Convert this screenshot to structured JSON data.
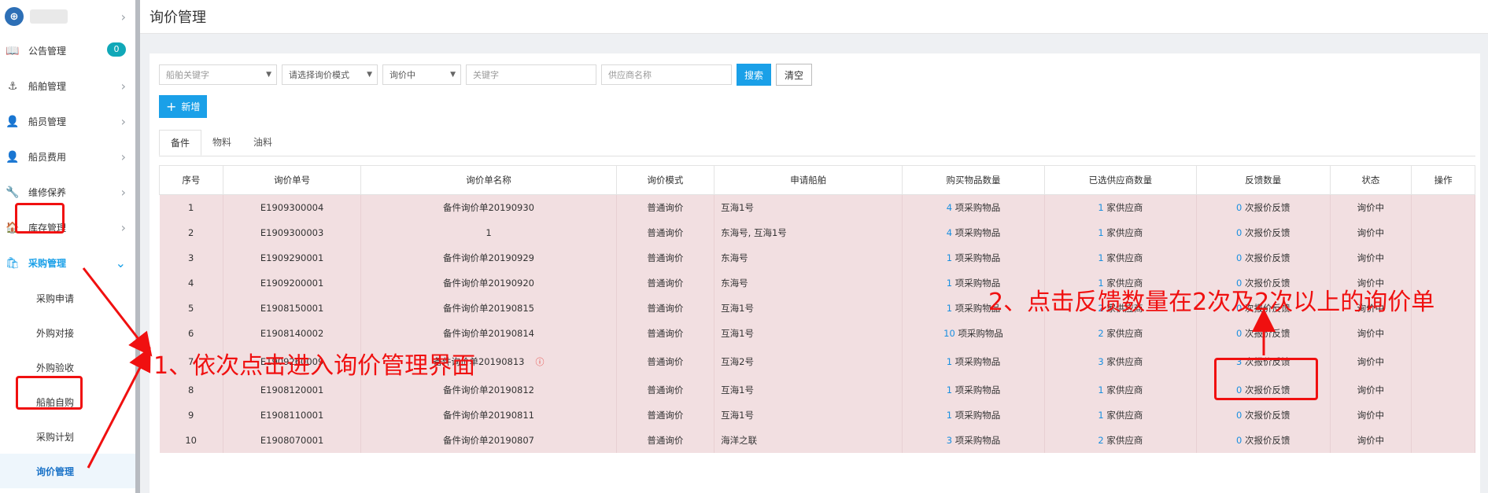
{
  "sidebar": {
    "logo_icon": "company-logo-icon",
    "menu": [
      {
        "label": "公告管理",
        "icon": "notice-icon",
        "badge": "0"
      },
      {
        "label": "船舶管理",
        "icon": "anchor-icon"
      },
      {
        "label": "船员管理",
        "icon": "crew-icon"
      },
      {
        "label": "船员费用",
        "icon": "crew-fee-icon"
      },
      {
        "label": "维修保养",
        "icon": "maintenance-icon"
      },
      {
        "label": "库存管理",
        "icon": "inventory-icon"
      },
      {
        "label": "采购管理",
        "icon": "purchase-icon"
      }
    ],
    "submenu": [
      "采购申请",
      "外购对接",
      "外购验收",
      "船舶自购",
      "采购计划",
      "询价管理"
    ]
  },
  "header": {
    "title": "询价管理"
  },
  "filters": {
    "ship_placeholder": "船舶关键字",
    "mode_placeholder": "请选择询价模式",
    "status_value": "询价中",
    "keyword_placeholder": "关键字",
    "supplier_placeholder": "供应商名称",
    "search_label": "搜索",
    "clear_label": "清空"
  },
  "add_label": "新增",
  "tabs": [
    "备件",
    "物料",
    "油料"
  ],
  "table": {
    "headers": [
      "序号",
      "询价单号",
      "询价单名称",
      "询价模式",
      "申请船舶",
      "购买物品数量",
      "已选供应商数量",
      "反馈数量",
      "状态",
      "操作"
    ],
    "suffix_items": "项采购物品",
    "suffix_suppliers": "家供应商",
    "suffix_feedback": "次报价反馈",
    "rows": [
      {
        "no": "1",
        "code": "E1909300004",
        "name": "备件询价单20190930",
        "mode": "普通询价",
        "ship": "互海1号",
        "items": "4",
        "suppliers": "1",
        "feedback": "0",
        "status": "询价中"
      },
      {
        "no": "2",
        "code": "E1909300003",
        "name": "1",
        "mode": "普通询价",
        "ship": "东海号, 互海1号",
        "items": "4",
        "suppliers": "1",
        "feedback": "0",
        "status": "询价中"
      },
      {
        "no": "3",
        "code": "E1909290001",
        "name": "备件询价单20190929",
        "mode": "普通询价",
        "ship": "东海号",
        "items": "1",
        "suppliers": "1",
        "feedback": "0",
        "status": "询价中"
      },
      {
        "no": "4",
        "code": "E1909200001",
        "name": "备件询价单20190920",
        "mode": "普通询价",
        "ship": "东海号",
        "items": "1",
        "suppliers": "1",
        "feedback": "0",
        "status": "询价中"
      },
      {
        "no": "5",
        "code": "E1908150001",
        "name": "备件询价单20190815",
        "mode": "普通询价",
        "ship": "互海1号",
        "items": "1",
        "suppliers": "2",
        "feedback": "0",
        "status": "询价中"
      },
      {
        "no": "6",
        "code": "E1908140002",
        "name": "备件询价单20190814",
        "mode": "普通询价",
        "ship": "互海1号",
        "items": "10",
        "suppliers": "2",
        "feedback": "0",
        "status": "询价中"
      },
      {
        "no": "7",
        "code": "E1909260009",
        "name": "备件询价单20190813",
        "mode": "普通询价",
        "ship": "互海2号",
        "items": "1",
        "suppliers": "3",
        "feedback": "3",
        "status": "询价中",
        "warning_icon": "info-circle-icon"
      },
      {
        "no": "8",
        "code": "E1908120001",
        "name": "备件询价单20190812",
        "mode": "普通询价",
        "ship": "互海1号",
        "items": "1",
        "suppliers": "1",
        "feedback": "0",
        "status": "询价中"
      },
      {
        "no": "9",
        "code": "E1908110001",
        "name": "备件询价单20190811",
        "mode": "普通询价",
        "ship": "互海1号",
        "items": "1",
        "suppliers": "1",
        "feedback": "0",
        "status": "询价中"
      },
      {
        "no": "10",
        "code": "E1908070001",
        "name": "备件询价单20190807",
        "mode": "普通询价",
        "ship": "海洋之联",
        "items": "3",
        "suppliers": "2",
        "feedback": "0",
        "status": "询价中"
      }
    ]
  },
  "annotations": {
    "step1": "1、依次点击进入询价管理界面",
    "step2": "2、点击反馈数量在2次及2次以上的询价单",
    "color": "#f01010"
  },
  "colors": {
    "accent": "#1aa0e8",
    "row_highlight": "#f2dfe1",
    "badge": "#10a8b8"
  }
}
